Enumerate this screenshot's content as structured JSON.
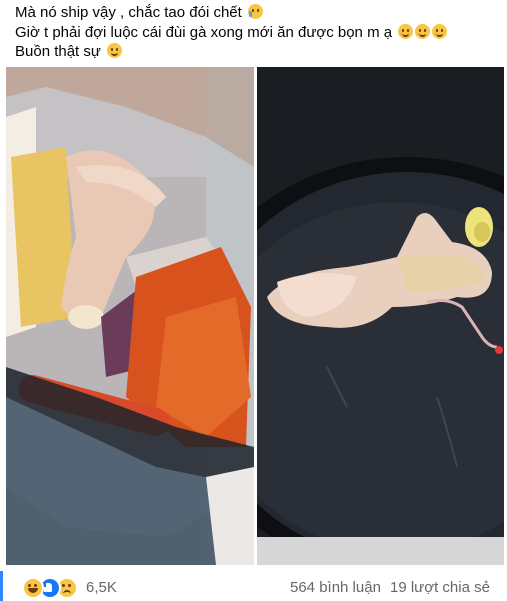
{
  "post": {
    "lines": [
      "Mà nó ship vậy , chắc tao đói chết",
      "Giờ t phải đợi luộc cái đùi gà xong mới ăn được bọn m ạ",
      "Buồn thật sự"
    ],
    "emojis": [
      "crying-face",
      "smiling-face",
      "smiling-face",
      "smiling-face",
      "slightly-smiling-face"
    ]
  },
  "photos": [
    {
      "description_icon": "photo-raw-chicken-in-bag"
    },
    {
      "description_icon": "photo-chicken-leg-in-pot"
    }
  ],
  "footer": {
    "reaction_count": "6,5K",
    "comments": "564 bình luận",
    "shares": "19 lượt chia sẻ",
    "accent": "#2d88ff"
  }
}
